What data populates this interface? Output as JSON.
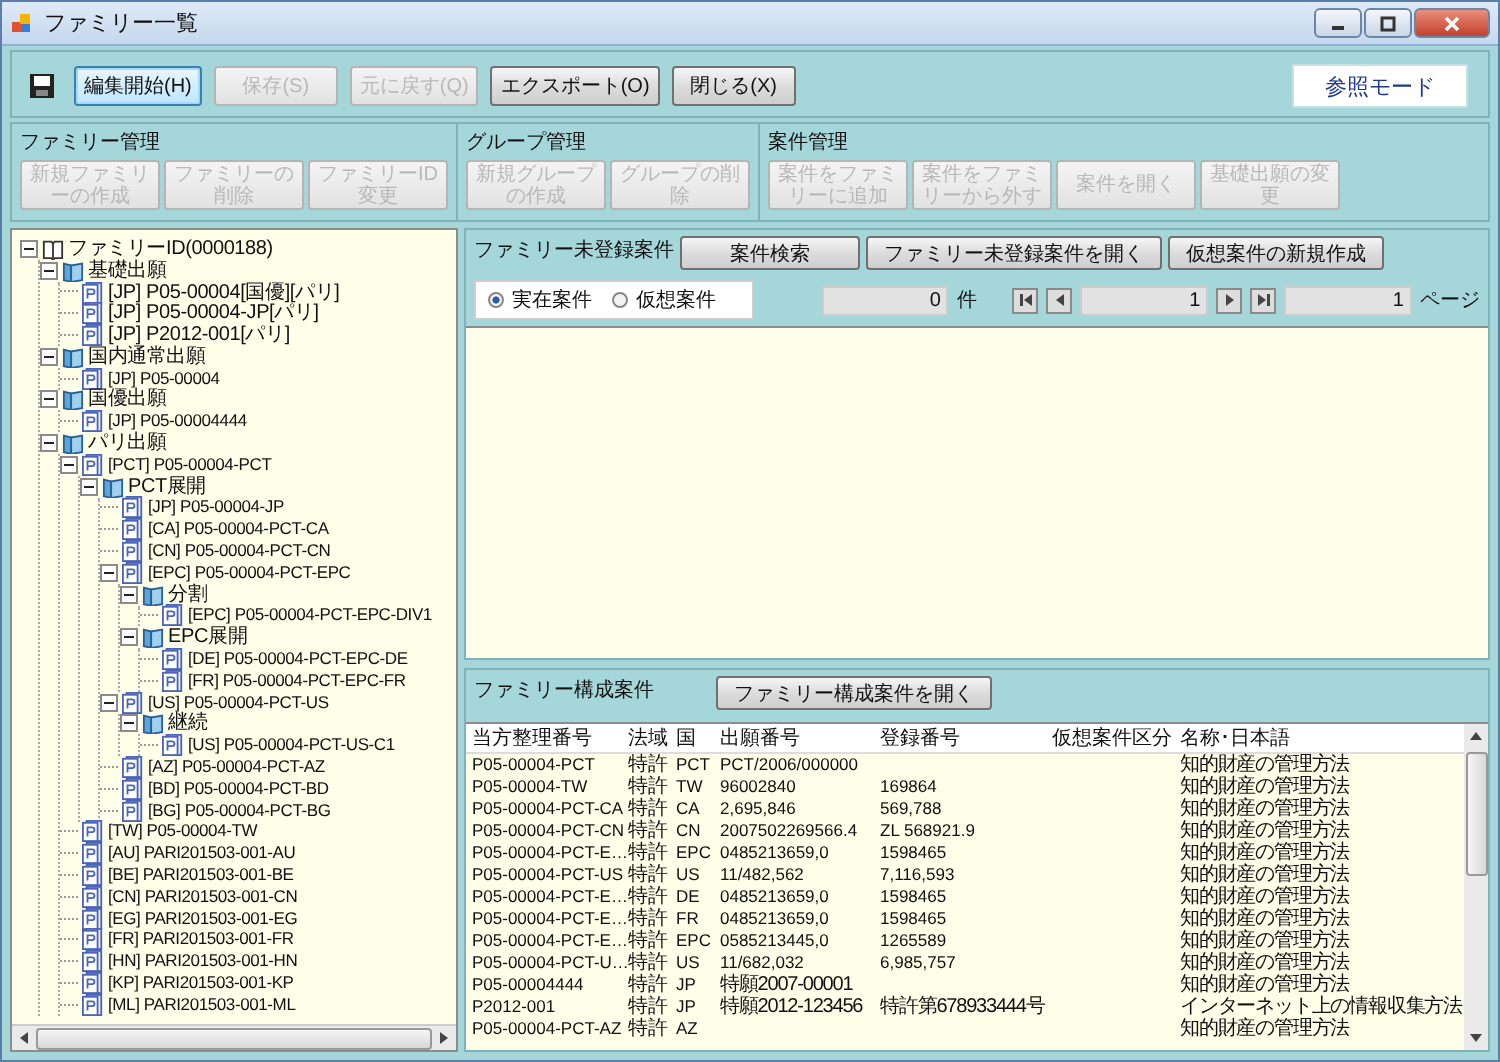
{
  "window": {
    "title": "ファミリー一覧"
  },
  "toolbar": {
    "buttons": [
      {
        "label": "編集開始(H)",
        "disabled": false,
        "focused": true
      },
      {
        "label": "保存(S)",
        "disabled": true,
        "focused": false
      },
      {
        "label": "元に戻す(Q)",
        "disabled": true,
        "focused": false
      },
      {
        "label": "エクスポート(O)",
        "disabled": false,
        "focused": false
      },
      {
        "label": "閉じる(X)",
        "disabled": false,
        "focused": false
      }
    ],
    "mode": "参照モード"
  },
  "groups": [
    {
      "title": "ファミリー管理",
      "buttons": [
        {
          "label": "新規ファミリーの作成",
          "disabled": true
        },
        {
          "label": "ファミリーの削除",
          "disabled": true
        },
        {
          "label": "ファミリーID変更",
          "disabled": true
        }
      ]
    },
    {
      "title": "グループ管理",
      "buttons": [
        {
          "label": "新規グループの作成",
          "disabled": true
        },
        {
          "label": "グループの削除",
          "disabled": true
        }
      ]
    },
    {
      "title": "案件管理",
      "buttons": [
        {
          "label": "案件をファミリーに追加",
          "disabled": true
        },
        {
          "label": "案件をファミリーから外す",
          "disabled": true
        },
        {
          "label": "案件を開く",
          "disabled": true
        },
        {
          "label": "基礎出願の変更",
          "disabled": true
        }
      ]
    }
  ],
  "tree": {
    "label": "ファミリーID(0000188)",
    "kind": "root",
    "expanded": true,
    "children": [
      {
        "label": "基礎出願",
        "kind": "folder",
        "expanded": true,
        "children": [
          {
            "label": "[JP] P05-00004[国優][パリ]",
            "kind": "doc"
          },
          {
            "label": "[JP] P05-00004-JP[パリ]",
            "kind": "doc"
          },
          {
            "label": "[JP] P2012-001[パリ]",
            "kind": "doc"
          }
        ]
      },
      {
        "label": "国内通常出願",
        "kind": "folder",
        "expanded": true,
        "children": [
          {
            "label": "[JP] P05-00004",
            "kind": "doc"
          }
        ]
      },
      {
        "label": "国優出願",
        "kind": "folder",
        "expanded": true,
        "children": [
          {
            "label": "[JP] P05-00004444",
            "kind": "doc"
          }
        ]
      },
      {
        "label": "パリ出願",
        "kind": "folder",
        "expanded": true,
        "children": [
          {
            "label": "[PCT] P05-00004-PCT",
            "kind": "doc",
            "expanded": true,
            "children": [
              {
                "label": "PCT展開",
                "kind": "folder",
                "expanded": true,
                "children": [
                  {
                    "label": "[JP] P05-00004-JP",
                    "kind": "doc"
                  },
                  {
                    "label": "[CA] P05-00004-PCT-CA",
                    "kind": "doc"
                  },
                  {
                    "label": "[CN] P05-00004-PCT-CN",
                    "kind": "doc"
                  },
                  {
                    "label": "[EPC] P05-00004-PCT-EPC",
                    "kind": "doc",
                    "expanded": true,
                    "children": [
                      {
                        "label": "分割",
                        "kind": "folder",
                        "expanded": true,
                        "children": [
                          {
                            "label": "[EPC] P05-00004-PCT-EPC-DIV1",
                            "kind": "doc"
                          }
                        ]
                      },
                      {
                        "label": "EPC展開",
                        "kind": "folder",
                        "expanded": true,
                        "children": [
                          {
                            "label": "[DE] P05-00004-PCT-EPC-DE",
                            "kind": "doc"
                          },
                          {
                            "label": "[FR] P05-00004-PCT-EPC-FR",
                            "kind": "doc"
                          }
                        ]
                      }
                    ]
                  },
                  {
                    "label": "[US] P05-00004-PCT-US",
                    "kind": "doc",
                    "expanded": true,
                    "children": [
                      {
                        "label": "継続",
                        "kind": "folder",
                        "expanded": true,
                        "children": [
                          {
                            "label": "[US] P05-00004-PCT-US-C1",
                            "kind": "doc"
                          }
                        ]
                      }
                    ]
                  },
                  {
                    "label": "[AZ] P05-00004-PCT-AZ",
                    "kind": "doc"
                  },
                  {
                    "label": "[BD] P05-00004-PCT-BD",
                    "kind": "doc"
                  },
                  {
                    "label": "[BG] P05-00004-PCT-BG",
                    "kind": "doc"
                  }
                ]
              }
            ]
          },
          {
            "label": "[TW] P05-00004-TW",
            "kind": "doc"
          },
          {
            "label": "[AU] PARI201503-001-AU",
            "kind": "doc"
          },
          {
            "label": "[BE] PARI201503-001-BE",
            "kind": "doc"
          },
          {
            "label": "[CN] PARI201503-001-CN",
            "kind": "doc"
          },
          {
            "label": "[EG] PARI201503-001-EG",
            "kind": "doc"
          },
          {
            "label": "[FR] PARI201503-001-FR",
            "kind": "doc"
          },
          {
            "label": "[HN] PARI201503-001-HN",
            "kind": "doc"
          },
          {
            "label": "[KP] PARI201503-001-KP",
            "kind": "doc"
          },
          {
            "label": "[ML] PARI201503-001-ML",
            "kind": "doc"
          }
        ]
      }
    ]
  },
  "unregistered": {
    "title": "ファミリー未登録案件",
    "buttons": [
      "案件検索",
      "ファミリー未登録案件を開く",
      "仮想案件の新規作成"
    ],
    "radios": [
      {
        "label": "実在案件",
        "selected": true
      },
      {
        "label": "仮想案件",
        "selected": false
      }
    ],
    "count": "0",
    "count_unit": "件",
    "page": "1",
    "total_pages": "1",
    "page_unit": "ページ"
  },
  "members": {
    "title": "ファミリー構成案件",
    "button": "ファミリー構成案件を開く",
    "columns": [
      "当方整理番号",
      "法域",
      "国",
      "出願番号",
      "登録番号",
      "仮想案件区分",
      "名称･日本語"
    ],
    "rows": [
      {
        "ref": "P05-00004-PCT",
        "law": "特許",
        "country": "PCT",
        "app_no": "PCT/2006/000000",
        "name": "知的財産の管理方法"
      },
      {
        "ref": "P05-00004-TW",
        "law": "特許",
        "country": "TW",
        "app_no": "96002840",
        "reg_no": "169864",
        "name": "知的財産の管理方法"
      },
      {
        "ref": "P05-00004-PCT-CA",
        "law": "特許",
        "country": "CA",
        "app_no": "2,695,846",
        "reg_no": "569,788",
        "name": "知的財産の管理方法"
      },
      {
        "ref": "P05-00004-PCT-CN",
        "law": "特許",
        "country": "CN",
        "app_no": "2007502269566.4",
        "reg_no": "ZL 568921.9",
        "name": "知的財産の管理方法"
      },
      {
        "ref": "P05-00004-PCT-E…",
        "law": "特許",
        "country": "EPC",
        "app_no": "0485213659,0",
        "reg_no": "1598465",
        "name": "知的財産の管理方法"
      },
      {
        "ref": "P05-00004-PCT-US",
        "law": "特許",
        "country": "US",
        "app_no": "11/482,562",
        "reg_no": "7,116,593",
        "name": "知的財産の管理方法"
      },
      {
        "ref": "P05-00004-PCT-E…",
        "law": "特許",
        "country": "DE",
        "app_no": "0485213659,0",
        "reg_no": "1598465",
        "name": "知的財産の管理方法"
      },
      {
        "ref": "P05-00004-PCT-E…",
        "law": "特許",
        "country": "FR",
        "app_no": "0485213659,0",
        "reg_no": "1598465",
        "name": "知的財産の管理方法"
      },
      {
        "ref": "P05-00004-PCT-E…",
        "law": "特許",
        "country": "EPC",
        "app_no": "0585213445,0",
        "reg_no": "1265589",
        "name": "知的財産の管理方法"
      },
      {
        "ref": "P05-00004-PCT-U…",
        "law": "特許",
        "country": "US",
        "app_no": "11/682,032",
        "reg_no": "6,985,757",
        "name": "知的財産の管理方法"
      },
      {
        "ref": "P05-00004444",
        "law": "特許",
        "country": "JP",
        "app_no": "特願2007-00001",
        "name": "知的財産の管理方法"
      },
      {
        "ref": "P2012-001",
        "law": "特許",
        "country": "JP",
        "app_no": "特願2012-123456",
        "reg_no": "特許第678933444号",
        "name": "インターネット上の情報収集方法"
      },
      {
        "ref": "P05-00004-PCT-AZ",
        "law": "特許",
        "country": "AZ",
        "name": "知的財産の管理方法"
      }
    ]
  }
}
